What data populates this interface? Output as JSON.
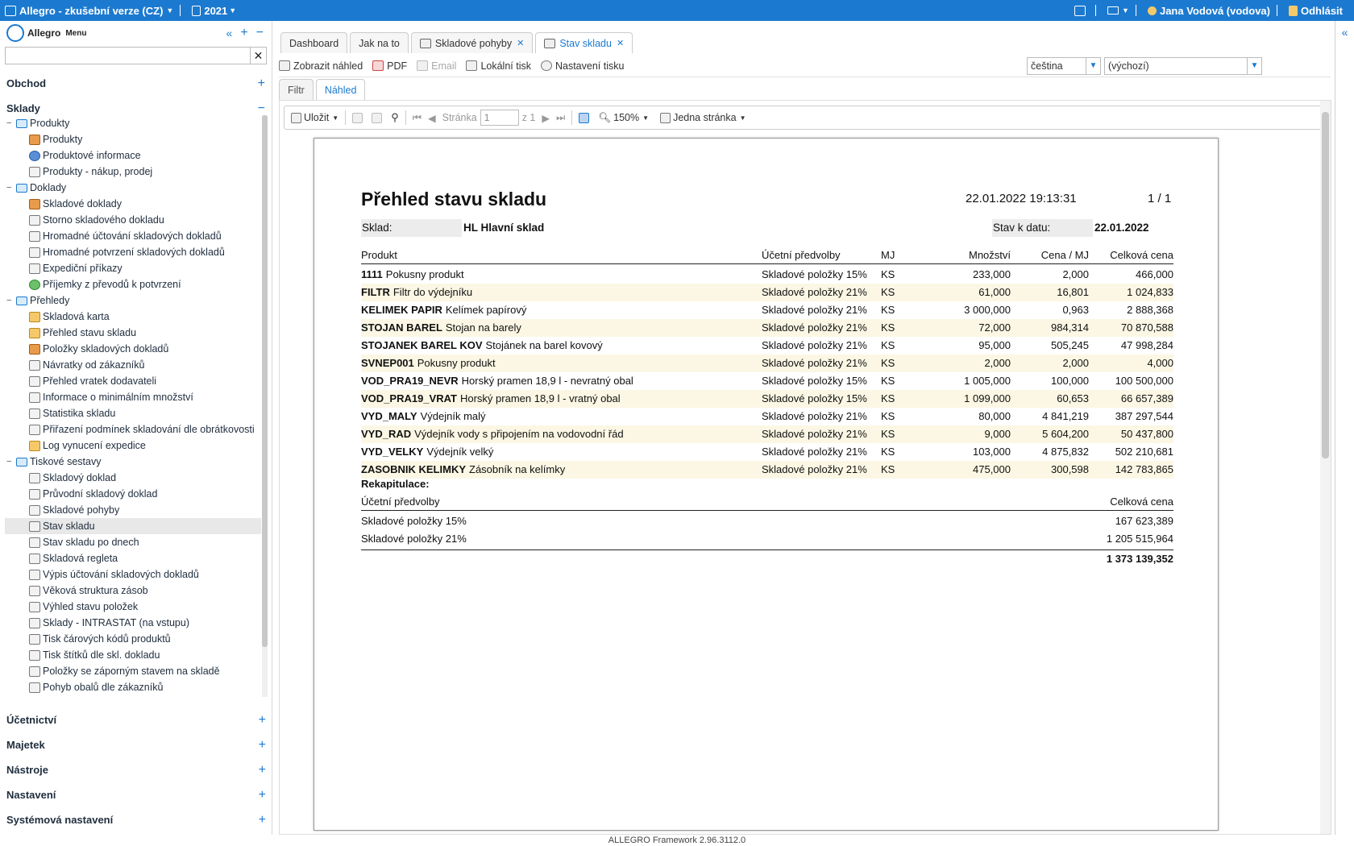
{
  "topbar": {
    "app_title": "Allegro - zkušební verze (CZ)",
    "year": "2021",
    "user": "Jana Vodová (vodova)",
    "logout": "Odhlásit",
    "bg_color": "#1b7ad0"
  },
  "sidebar": {
    "logo_text": "Allegro",
    "menu_label": "Menu",
    "search_placeholder": "",
    "sections_top": [
      "Obchod",
      "Sklady"
    ],
    "tree": [
      {
        "label": "Produkty",
        "group": true
      },
      {
        "label": "Produkty",
        "icon": "products-icon"
      },
      {
        "label": "Produktové informace",
        "icon": "info-icon"
      },
      {
        "label": "Produkty - nákup, prodej",
        "icon": "exchange-icon"
      },
      {
        "label": "Doklady",
        "group": true
      },
      {
        "label": "Skladové doklady",
        "icon": "documents-icon"
      },
      {
        "label": "Storno skladového dokladu",
        "icon": "storno-icon"
      },
      {
        "label": "Hromadné účtování skladových dokladů",
        "icon": "bulk-icon"
      },
      {
        "label": "Hromadné potvrzení skladových dokladů",
        "icon": "bulk-icon"
      },
      {
        "label": "Expediční příkazy",
        "icon": "expedition-icon"
      },
      {
        "label": "Příjemky z převodů k potvrzení",
        "icon": "check-icon"
      },
      {
        "label": "Přehledy",
        "group": true
      },
      {
        "label": "Skladová karta",
        "icon": "card-icon"
      },
      {
        "label": "Přehled stavu skladu",
        "icon": "report-icon"
      },
      {
        "label": "Položky skladových dokladů",
        "icon": "items-icon"
      },
      {
        "label": "Návratky od zákazníků",
        "icon": "return-icon"
      },
      {
        "label": "Přehled vratek dodavateli",
        "icon": "cart-icon"
      },
      {
        "label": "Informace o minimálním množství",
        "icon": "table-icon"
      },
      {
        "label": "Statistika skladu",
        "icon": "table-icon"
      },
      {
        "label": "Přiřazení podmínek skladování dle obrátkovosti",
        "icon": "window-icon"
      },
      {
        "label": "Log vynucení expedice",
        "icon": "log-icon"
      },
      {
        "label": "Tiskové sestavy",
        "group": true
      },
      {
        "label": "Skladový doklad",
        "icon": "printer-icon"
      },
      {
        "label": "Průvodní skladový doklad",
        "icon": "printer-icon"
      },
      {
        "label": "Skladové pohyby",
        "icon": "printer-icon"
      },
      {
        "label": "Stav skladu",
        "icon": "printer-icon",
        "selected": true
      },
      {
        "label": "Stav skladu po dnech",
        "icon": "printer-icon"
      },
      {
        "label": "Skladová regleta",
        "icon": "printer-icon"
      },
      {
        "label": "Výpis účtování skladových dokladů",
        "icon": "printer-icon"
      },
      {
        "label": "Věková struktura zásob",
        "icon": "printer-icon"
      },
      {
        "label": "Výhled stavu položek",
        "icon": "printer-icon"
      },
      {
        "label": "Sklady - INTRASTAT (na vstupu)",
        "icon": "printer-icon"
      },
      {
        "label": "Tisk čárových kódů produktů",
        "icon": "printer-icon"
      },
      {
        "label": "Tisk štítků dle skl. dokladu",
        "icon": "printer-icon"
      },
      {
        "label": "Položky se záporným stavem na skladě",
        "icon": "printer-icon"
      },
      {
        "label": "Pohyb obalů dle zákazníků",
        "icon": "printer-icon"
      }
    ],
    "sections_bottom": [
      "Účetnictví",
      "Majetek",
      "Nástroje",
      "Nastavení",
      "Systémová nastavení"
    ]
  },
  "tabs": [
    {
      "label": "Dashboard"
    },
    {
      "label": "Jak na to"
    },
    {
      "label": "Skladové pohyby",
      "closable": true
    },
    {
      "label": "Stav skladu",
      "closable": true,
      "active": true
    }
  ],
  "toolbar": {
    "preview": "Zobrazit náhled",
    "pdf": "PDF",
    "email": "Email",
    "local_print": "Lokální tisk",
    "print_settings": "Nastavení tisku",
    "language": "čeština",
    "printer": "(výchozí)"
  },
  "subtabs": {
    "filter": "Filtr",
    "preview": "Náhled"
  },
  "viewer": {
    "save": "Uložit",
    "page_label": "Stránka",
    "page_value": "1",
    "page_of": "z 1",
    "zoom": "150%",
    "page_mode": "Jedna stránka"
  },
  "report": {
    "title": "Přehled stavu skladu",
    "datetime": "22.01.2022 19:13:31",
    "page": "1 / 1",
    "sklad_label": "Sklad:",
    "sklad_value": "HL Hlavní sklad",
    "date_label": "Stav k datu:",
    "date_value": "22.01.2022",
    "headers": [
      "Produkt",
      "Účetní předvolby",
      "MJ",
      "Množství",
      "Cena / MJ",
      "Celková cena"
    ],
    "rows": [
      {
        "code": "1111",
        "name": "Pokusny produkt",
        "acc": "Skladové položky 15%",
        "mj": "KS",
        "qty": "233,000",
        "price": "2,000",
        "total": "466,000"
      },
      {
        "code": "FILTR",
        "name": "Filtr do výdejníku",
        "acc": "Skladové položky 21%",
        "mj": "KS",
        "qty": "61,000",
        "price": "16,801",
        "total": "1 024,833"
      },
      {
        "code": "KELIMEK PAPIR",
        "name": "Kelímek papírový",
        "acc": "Skladové položky 21%",
        "mj": "KS",
        "qty": "3 000,000",
        "price": "0,963",
        "total": "2 888,368"
      },
      {
        "code": "STOJAN BAREL",
        "name": "Stojan na barely",
        "acc": "Skladové položky 21%",
        "mj": "KS",
        "qty": "72,000",
        "price": "984,314",
        "total": "70 870,588"
      },
      {
        "code": "STOJANEK BAREL KOV",
        "name": "Stojánek na barel kovový",
        "acc": "Skladové položky 21%",
        "mj": "KS",
        "qty": "95,000",
        "price": "505,245",
        "total": "47 998,284"
      },
      {
        "code": "SVNEP001",
        "name": "Pokusny produkt",
        "acc": "Skladové položky 21%",
        "mj": "KS",
        "qty": "2,000",
        "price": "2,000",
        "total": "4,000"
      },
      {
        "code": "VOD_PRA19_NEVR",
        "name": "Horský pramen 18,9 l - nevratný obal",
        "acc": "Skladové položky 15%",
        "mj": "KS",
        "qty": "1 005,000",
        "price": "100,000",
        "total": "100 500,000"
      },
      {
        "code": "VOD_PRA19_VRAT",
        "name": "Horský pramen 18,9 l - vratný obal",
        "acc": "Skladové položky 15%",
        "mj": "KS",
        "qty": "1 099,000",
        "price": "60,653",
        "total": "66 657,389"
      },
      {
        "code": "VYD_MALY",
        "name": "Výdejník malý",
        "acc": "Skladové položky 21%",
        "mj": "KS",
        "qty": "80,000",
        "price": "4 841,219",
        "total": "387 297,544"
      },
      {
        "code": "VYD_RAD",
        "name": "Výdejník vody s připojením na vodovodní řád",
        "acc": "Skladové položky 21%",
        "mj": "KS",
        "qty": "9,000",
        "price": "5 604,200",
        "total": "50 437,800"
      },
      {
        "code": "VYD_VELKY",
        "name": "Výdejník velký",
        "acc": "Skladové položky 21%",
        "mj": "KS",
        "qty": "103,000",
        "price": "4 875,832",
        "total": "502 210,681"
      },
      {
        "code": "ZASOBNIK KELIMKY",
        "name": "Zásobník na kelímky",
        "acc": "Skladové položky 21%",
        "mj": "KS",
        "qty": "475,000",
        "price": "300,598",
        "total": "142 783,865"
      }
    ],
    "recap_title": "Rekapitulace:",
    "recap_headers": [
      "Účetní předvolby",
      "Celková cena"
    ],
    "recap_rows": [
      {
        "label": "Skladové položky 15%",
        "value": "167 623,389"
      },
      {
        "label": "Skladové položky 21%",
        "value": "1 205 515,964"
      }
    ],
    "recap_total": "1 373 139,352"
  },
  "footer": "ALLEGRO Framework 2.96.3112.0"
}
